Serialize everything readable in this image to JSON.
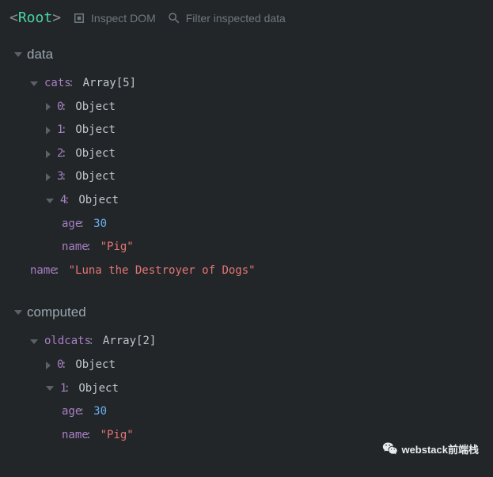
{
  "header": {
    "root_label": "Root",
    "inspect_label": "Inspect DOM",
    "filter_placeholder": "Filter inspected data"
  },
  "sections": {
    "data": {
      "title": "data",
      "cats": {
        "key": "cats",
        "type": "Array[5]",
        "items": [
          {
            "idx": "0",
            "type": "Object",
            "expanded": false
          },
          {
            "idx": "1",
            "type": "Object",
            "expanded": false
          },
          {
            "idx": "2",
            "type": "Object",
            "expanded": false
          },
          {
            "idx": "3",
            "type": "Object",
            "expanded": false
          },
          {
            "idx": "4",
            "type": "Object",
            "expanded": true,
            "age_key": "age",
            "age_val": "30",
            "name_key": "name",
            "name_val": "\"Pig\""
          }
        ]
      },
      "name": {
        "key": "name",
        "val": "\"Luna the Destroyer of Dogs\""
      }
    },
    "computed": {
      "title": "computed",
      "oldcats": {
        "key": "oldcats",
        "type": "Array[2]",
        "items": [
          {
            "idx": "0",
            "type": "Object",
            "expanded": false
          },
          {
            "idx": "1",
            "type": "Object",
            "expanded": true,
            "age_key": "age",
            "age_val": "30",
            "name_key": "name",
            "name_val": "\"Pig\""
          }
        ]
      }
    }
  },
  "footer": {
    "label": "webstack前端栈"
  }
}
